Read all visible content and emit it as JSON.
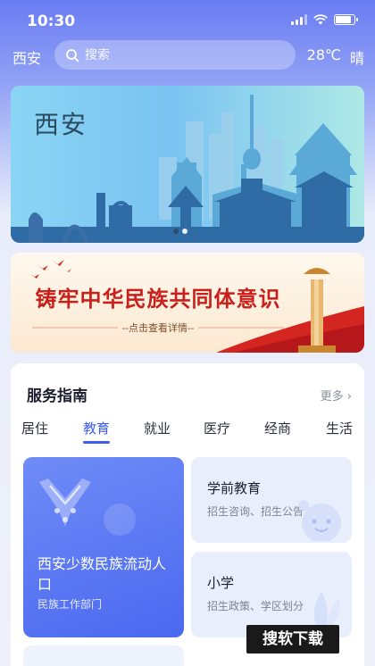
{
  "status_bar": {
    "time": "10:30"
  },
  "header": {
    "city": "西安",
    "search_placeholder": "搜索",
    "temperature": "28℃",
    "weather": "晴"
  },
  "hero_banner": {
    "title": "西安",
    "active_slide": 1,
    "slide_count": 2
  },
  "promo_banner": {
    "title": "铸牢中华民族共同体意识",
    "subtitle": "--点击查看详情--"
  },
  "service": {
    "title": "服务指南",
    "more_label": "更多 ›",
    "tabs": [
      "居住",
      "教育",
      "就业",
      "医疗",
      "经商",
      "生活"
    ],
    "active_tab": 1,
    "featured": {
      "title": "西安少数民族流动人口",
      "subtitle": "民族工作部门"
    },
    "items": [
      {
        "title": "学前教育",
        "subtitle": "招生咨询、招生公告"
      },
      {
        "title": "小学",
        "subtitle": "招生政策、学区划分"
      }
    ]
  },
  "watermark": "搜软下载",
  "colors": {
    "accent": "#3d5cf5",
    "header_bg": "#6a7cf3"
  }
}
